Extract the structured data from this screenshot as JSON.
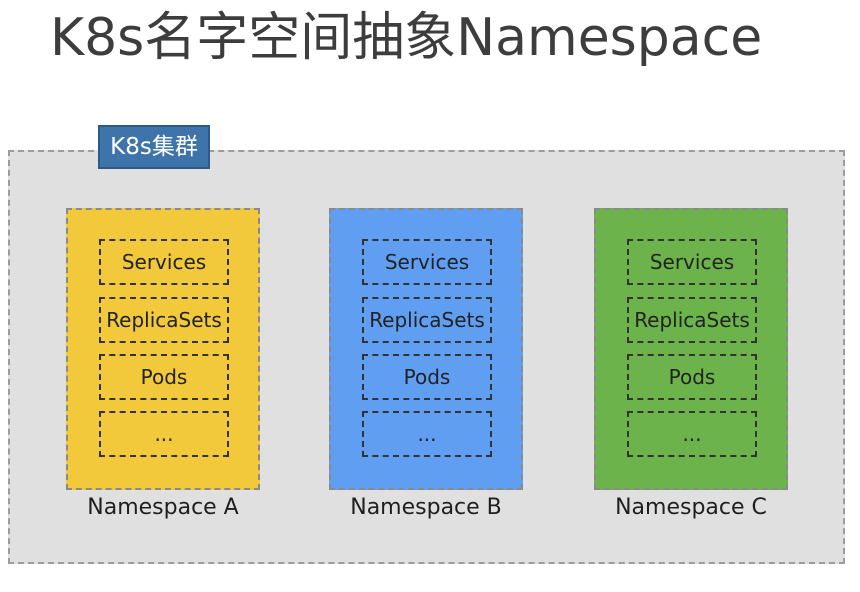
{
  "title": "K8s名字空间抽象Namespace",
  "cluster": {
    "label": "K8s集群"
  },
  "namespaces": [
    {
      "name": "Namespace A",
      "color": "#f2c93a",
      "items": [
        "Services",
        "ReplicaSets",
        "Pods",
        "..."
      ]
    },
    {
      "name": "Namespace B",
      "color": "#5f9ef0",
      "items": [
        "Services",
        "ReplicaSets",
        "Pods",
        "..."
      ]
    },
    {
      "name": "Namespace C",
      "color": "#6bb34a",
      "items": [
        "Services",
        "ReplicaSets",
        "Pods",
        "..."
      ]
    }
  ],
  "colors": {
    "cluster_bg": "#e0e0e0",
    "badge_bg": "#3f74ab",
    "title_text": "#3d3d3d"
  }
}
